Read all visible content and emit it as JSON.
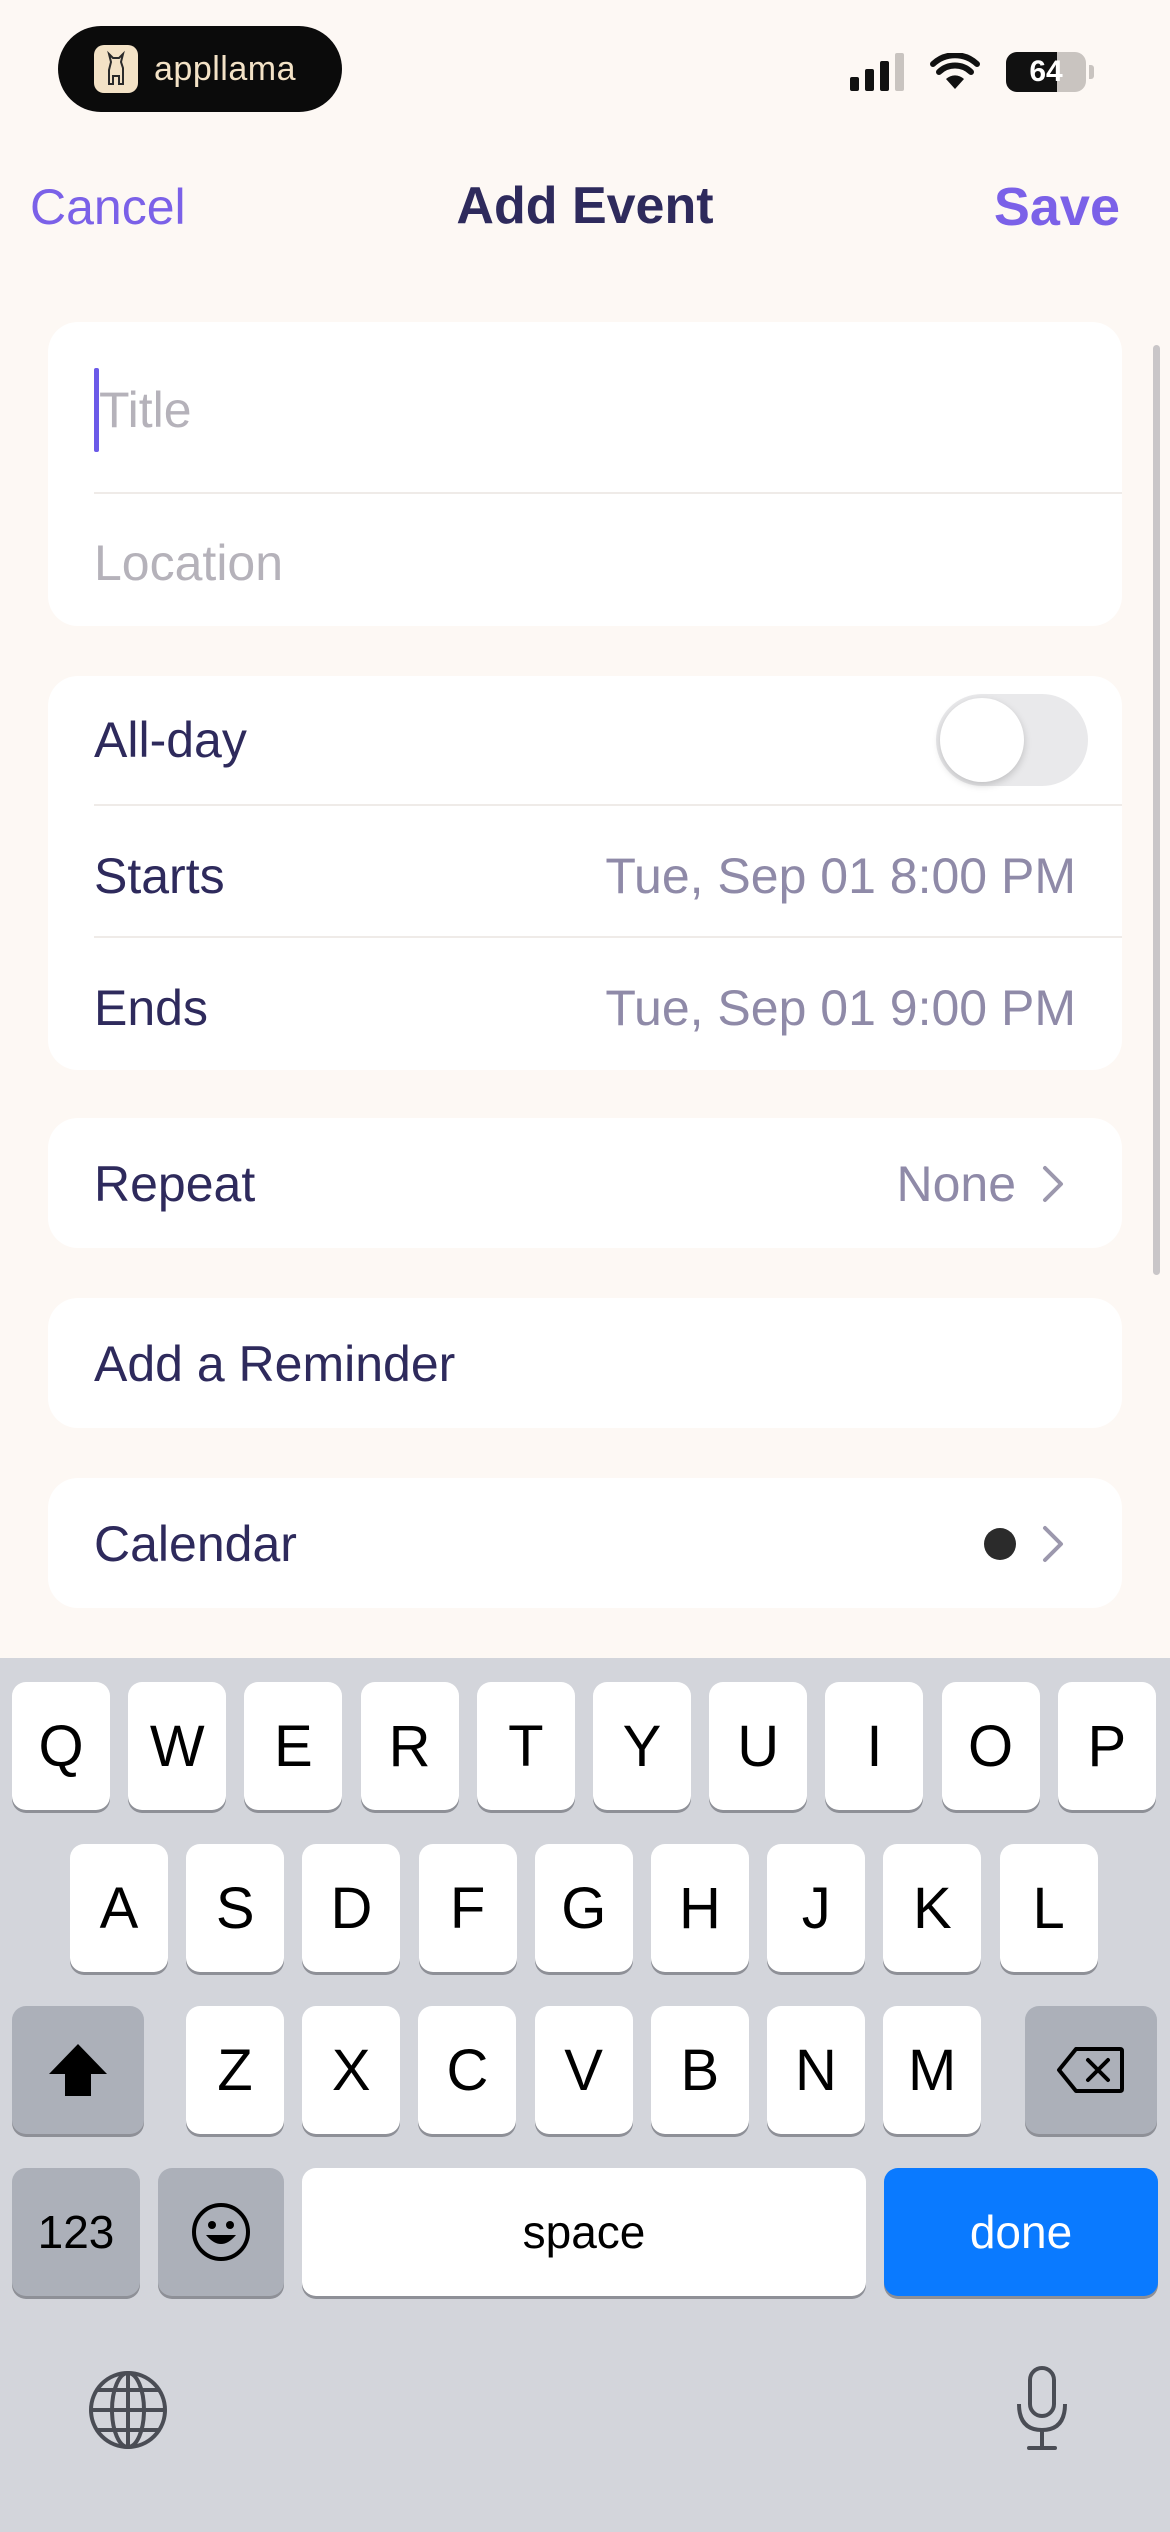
{
  "status_bar": {
    "app_name": "appllama",
    "battery_level": "64",
    "battery_fraction": 0.64,
    "signal_bars": 3
  },
  "nav": {
    "cancel_label": "Cancel",
    "title": "Add Event",
    "save_label": "Save"
  },
  "title_card": {
    "title_placeholder": "Title",
    "location_placeholder": "Location"
  },
  "time_card": {
    "all_day_label": "All-day",
    "all_day_enabled": false,
    "starts_label": "Starts",
    "starts_value": "Tue, Sep 01 8:00 PM",
    "ends_label": "Ends",
    "ends_value": "Tue, Sep 01 9:00 PM"
  },
  "repeat": {
    "label": "Repeat",
    "value": "None"
  },
  "reminder": {
    "label": "Add a Reminder"
  },
  "calendar": {
    "label": "Calendar",
    "color": "#2b2b2b"
  },
  "colors": {
    "accent": "#7b61e8",
    "text_primary": "#2e2a5c",
    "text_secondary": "#8f8aa8",
    "background": "#fdf8f4",
    "keyboard_done": "#0a7aff"
  },
  "keyboard": {
    "row1": [
      "Q",
      "W",
      "E",
      "R",
      "T",
      "Y",
      "U",
      "I",
      "O",
      "P"
    ],
    "row2": [
      "A",
      "S",
      "D",
      "F",
      "G",
      "H",
      "J",
      "K",
      "L"
    ],
    "row3": [
      "Z",
      "X",
      "C",
      "V",
      "B",
      "N",
      "M"
    ],
    "numbers_label": "123",
    "space_label": "space",
    "done_label": "done"
  }
}
